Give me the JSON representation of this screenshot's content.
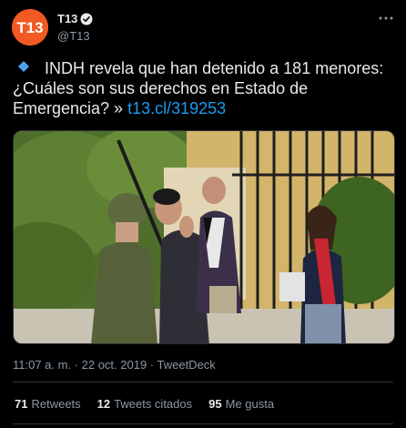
{
  "author": {
    "avatar_text": "T13",
    "display_name": "T13",
    "handle": "@T13",
    "brand_color": "#f15a22",
    "verified": true
  },
  "tweet": {
    "text": "INDH revela que han detenido a 181 menores: ¿Cuáles son sus derechos en Estado de Emergencia? »",
    "link": "t13.cl/319253",
    "leading_icon": "diamond-icon"
  },
  "meta": {
    "timestamp": "11:07 a. m. · 22 oct. 2019 · TweetDeck"
  },
  "stats": {
    "retweets_count": "71",
    "retweets_label": "Retweets",
    "quotes_count": "12",
    "quotes_label": "Tweets citados",
    "likes_count": "95",
    "likes_label": "Me gusta"
  },
  "colors": {
    "background": "#000000",
    "text": "#e7e9ea",
    "secondary": "#8b98a5",
    "link": "#1d9bf0",
    "divider": "#2f3336"
  }
}
